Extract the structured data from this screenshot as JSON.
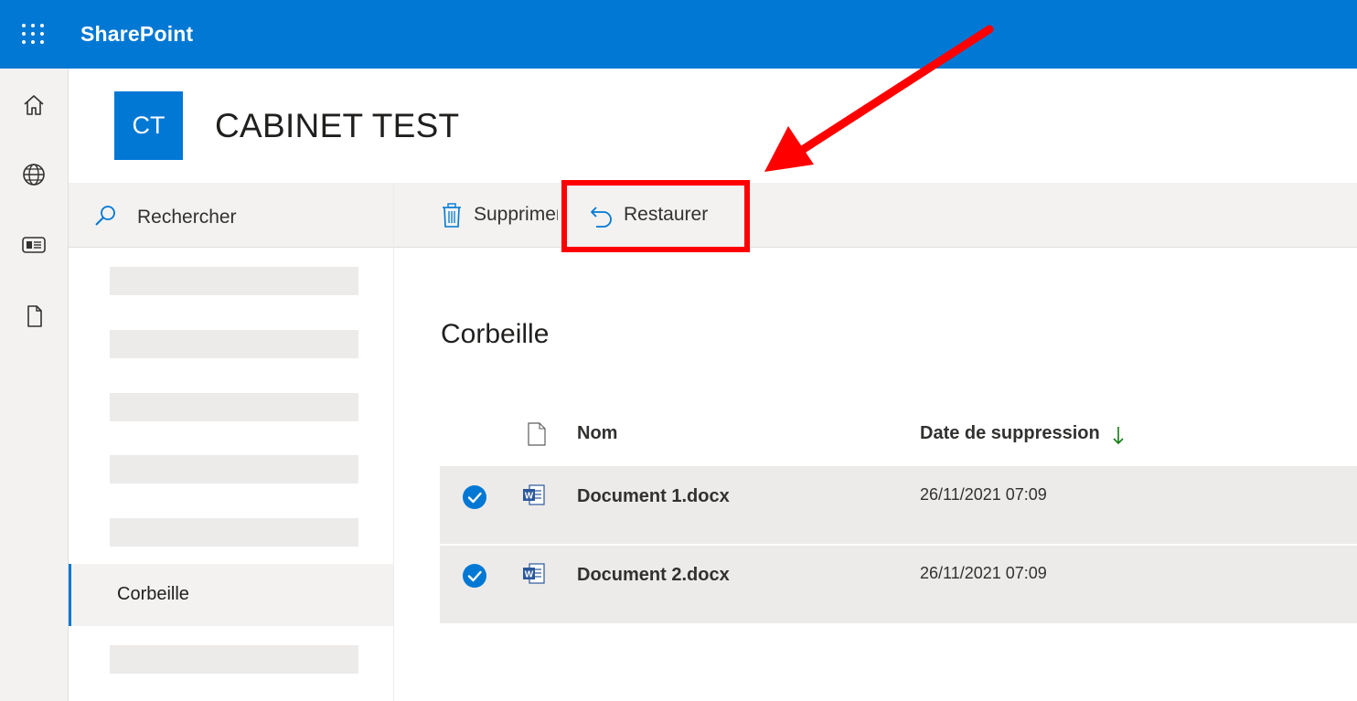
{
  "app": {
    "brand": "SharePoint",
    "brand_color": "#0078d4",
    "rail_icons": [
      "home-icon",
      "globe-icon",
      "news-icon",
      "document-icon"
    ]
  },
  "site": {
    "logo_initials": "CT",
    "title": "CABINET TEST"
  },
  "nav": {
    "search_label": "Rechercher",
    "placeholder_items_count": 6,
    "selected_item": "Corbeille"
  },
  "commandbar": {
    "delete_label": "Supprimer",
    "restore_label": "Restaurer"
  },
  "annotation": {
    "highlight_color": "#ff0000",
    "target": "Restaurer"
  },
  "main": {
    "title": "Corbeille",
    "columns": {
      "name": "Nom",
      "date": "Date de suppression",
      "date_sort": "descending"
    },
    "rows": [
      {
        "name": "Document 1.docx",
        "date": "26/11/2021 07:09",
        "selected": true,
        "icon": "word-icon"
      },
      {
        "name": "Document 2.docx",
        "date": "26/11/2021 07:09",
        "selected": true,
        "icon": "word-icon"
      }
    ]
  }
}
